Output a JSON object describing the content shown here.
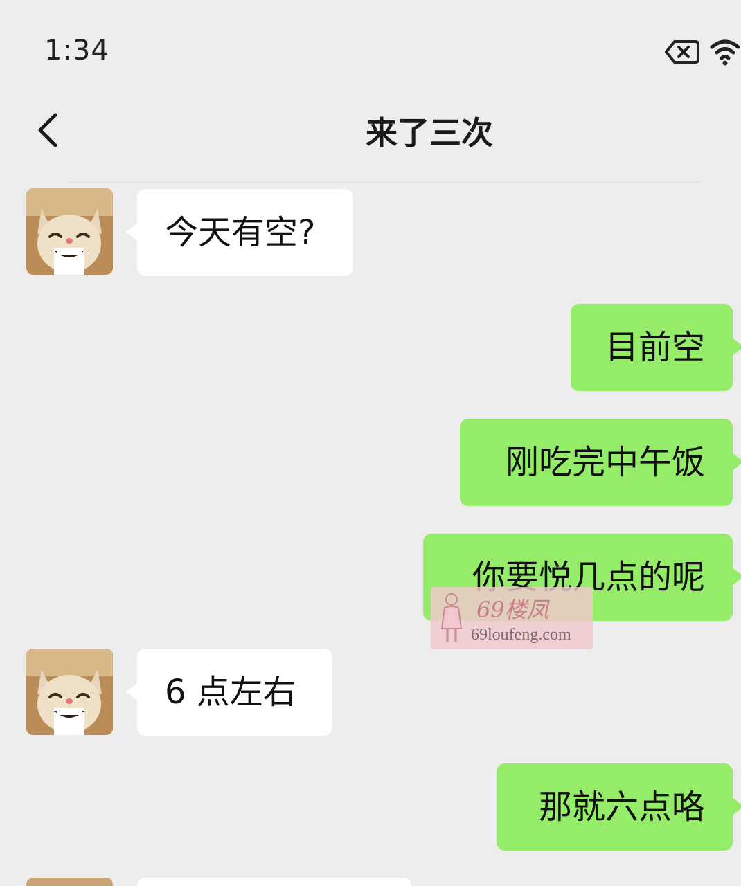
{
  "status_bar": {
    "time": "1:34",
    "icons": [
      "battery-x-icon",
      "wifi-icon"
    ]
  },
  "header": {
    "back_icon": "chevron-left-icon",
    "title": "来了三次"
  },
  "messages": [
    {
      "side": "in",
      "text": "今天有空?"
    },
    {
      "side": "out",
      "text": "目前空"
    },
    {
      "side": "out",
      "text": "刚吃完中午饭"
    },
    {
      "side": "out",
      "text": "你要悦几点的呢"
    },
    {
      "side": "in",
      "text": "6 点左右"
    },
    {
      "side": "out",
      "text": "那就六点咯"
    }
  ],
  "watermark": {
    "line1": "69楼凤",
    "line2": "69loufeng.com"
  },
  "colors": {
    "background": "#ededed",
    "incoming_bubble": "#ffffff",
    "outgoing_bubble": "#95ec69"
  }
}
